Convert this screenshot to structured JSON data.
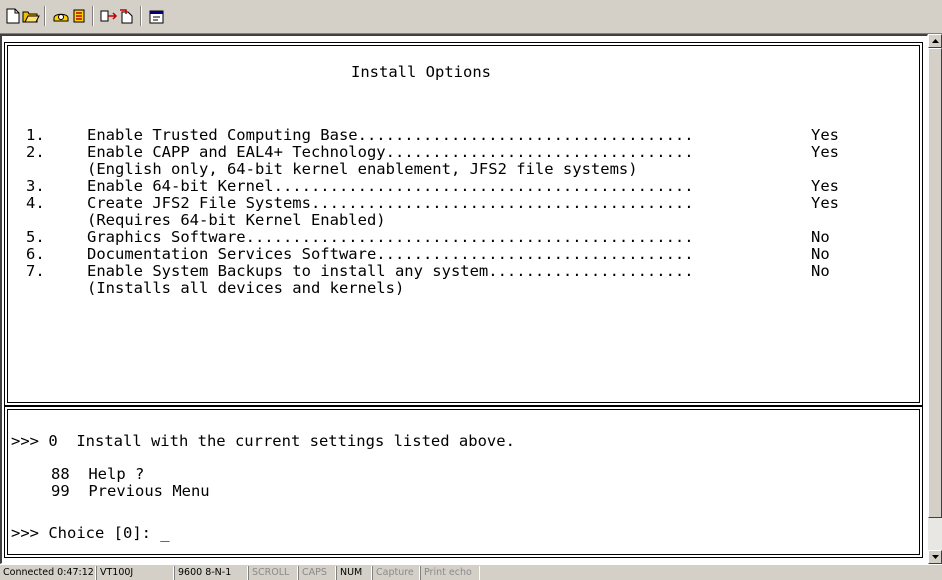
{
  "toolbar": {
    "buttons": [
      "new-icon",
      "open-icon",
      "connect-icon",
      "disconnect-icon",
      "send-icon",
      "receive-icon",
      "properties-icon"
    ]
  },
  "terminal": {
    "title": "Install Options",
    "options": [
      {
        "num": "1.",
        "text": "Enable Trusted Computing Base....................................",
        "value": "Yes"
      },
      {
        "num": "2.",
        "text": "Enable CAPP and EAL4+ Technology.................................",
        "value": "Yes"
      },
      {
        "num": "",
        "text": "(English only, 64-bit kernel enablement, JFS2 file systems)",
        "value": ""
      },
      {
        "num": "3.",
        "text": "Enable 64-bit Kernel.............................................",
        "value": "Yes"
      },
      {
        "num": "4.",
        "text": "Create JFS2 File Systems.........................................",
        "value": "Yes"
      },
      {
        "num": "",
        "text": "(Requires 64-bit Kernel Enabled)",
        "value": ""
      },
      {
        "num": "5.",
        "text": "Graphics Software................................................",
        "value": "No"
      },
      {
        "num": "6.",
        "text": "Documentation Services Software..................................",
        "value": "No"
      },
      {
        "num": "7.",
        "text": "Enable System Backups to install any system......................",
        "value": "No"
      },
      {
        "num": "",
        "text": "(Installs all devices and kernels)",
        "value": ""
      }
    ],
    "install_line": ">>> 0  Install with the current settings listed above.",
    "help_line": "88  Help ?",
    "prev_line": "99  Previous Menu",
    "choice_line": ">>> Choice [0]: _"
  },
  "statusbar": {
    "connected": "Connected 0:47:12",
    "emulation": "VT100J",
    "port": "9600 8-N-1",
    "scroll": "SCROLL",
    "caps": "CAPS",
    "num": "NUM",
    "capture": "Capture",
    "print_echo": "Print echo"
  }
}
